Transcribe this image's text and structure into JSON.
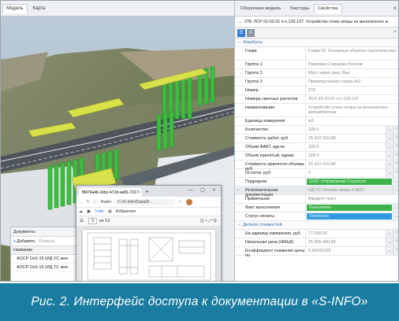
{
  "left_tabs": [
    "Модель",
    "Карта"
  ],
  "panel": {
    "tabs": [
      "Сборочная модель",
      "Текстуры",
      "Свойства"
    ],
    "active_tab": 2,
    "object_title": "278. ЛСР 02-02-01 п.п.129-137. Устройство стоек опоры из монолитного ж",
    "section_attributes": "Атрибуты",
    "rows": [
      {
        "label": "Глава",
        "value": "Глава 02. Основные объекты строительства",
        "lines": 2
      },
      {
        "label": "Группа 1",
        "value": "Развязка Старцева-Ухолом"
      },
      {
        "label": "Группа 2",
        "value": "Мост через реку Иня"
      },
      {
        "label": "Группа 3",
        "value": "Промежуточная опора №2"
      },
      {
        "label": "Номер",
        "value": "278"
      },
      {
        "label": "Номера сметных расчетов",
        "value": "ЛСР 02-02-01 п.п.129-137"
      },
      {
        "label": "Наименование",
        "value": "Устройство стоек опоры из монолитного железобетона",
        "lines": 2
      },
      {
        "label": "Единица измерения",
        "value": "м3"
      },
      {
        "label": "Количество",
        "value": "328.4",
        "ctl": true
      },
      {
        "label": "Стоимость работ, руб.",
        "value": "25 422 016,88",
        "ctl": true
      },
      {
        "label": "Объем ФАКТ, вдсле.",
        "value": "328.8",
        "ctl": true
      },
      {
        "label": "Объем принятый, едизм.",
        "value": "328.4",
        "ctl": true
      },
      {
        "label": "Стоимость принятого объема, руб.",
        "value": "25 422 016,88",
        "ctl": true
      },
      {
        "label": "Остаток, руб.",
        "value": "0",
        "ctl": true
      },
      {
        "label": "Подрядчик",
        "value": "ООО «Управление Строител",
        "style": "green",
        "btn": true
      },
      {
        "label": "Исполнительная документация",
        "value": "ИД УС Оплеба опора 2 АОП",
        "grey": true,
        "btn": true,
        "arrow": true
      },
      {
        "label": "Примечание",
        "value": "Введите текст"
      },
      {
        "label": "Факт выполнения",
        "value": "Выполнено",
        "style": "green",
        "btn": true
      },
      {
        "label": "Статус оплаты",
        "value": "Оплачено",
        "style": "blue",
        "btn": true
      }
    ],
    "section_costs": "Детали стоимостей",
    "cost_rows": [
      {
        "label": "На единицу измерения, руб.",
        "value": "77 048,55",
        "ctl": true
      },
      {
        "label": "Начальная цена (НМЦК)",
        "value": "25 565 460,89",
        "ctl": true
      },
      {
        "label": "Коэффициент снижения цены по",
        "value": "0,99439195",
        "ctl": true
      }
    ]
  },
  "docs": {
    "title": "Документы",
    "add_label": "Добавить",
    "open_label": "Открыть",
    "col_header": "Название",
    "items": [
      "АОСР Оп2-15 (ИД УС мон",
      "АОСР Оп2-16 (ИД УС мон"
    ]
  },
  "browser": {
    "tab_title": "f8476a4b-1bbc-472d-ae81-7217",
    "new_tab": "+",
    "address_prefix": "Файл",
    "address": "C:/S-Info/Data/D...",
    "favorites": [
      "Trello",
      "Избранное"
    ],
    "page_number": "3",
    "page_total": "из 13",
    "pdf_tools": "Q  +  ⤢  ⚙"
  },
  "caption": "Рис. 2. Интерфейс доступа к документации в «S-INFO»"
}
